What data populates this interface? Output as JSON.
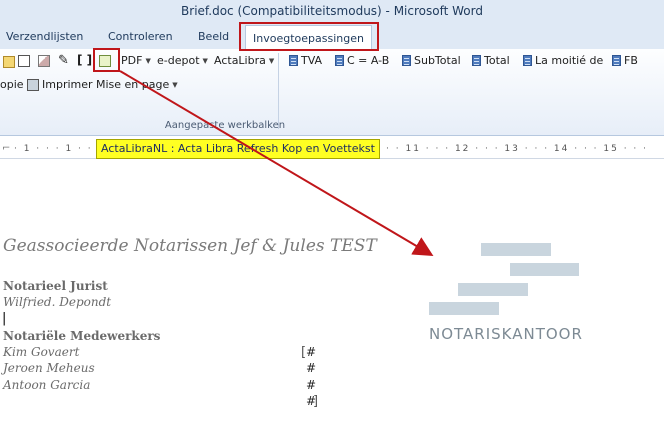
{
  "window": {
    "title": "Brief.doc (Compatibiliteitsmodus)  -  Microsoft Word",
    "ghost_left": "Brief",
    "ghost_right": ""
  },
  "tabs": [
    {
      "label": "Verzendlijsten"
    },
    {
      "label": "Controleren"
    },
    {
      "label": "Beeld"
    },
    {
      "label": "Invoegtoepassingen"
    }
  ],
  "ribbon": {
    "row1": {
      "pdf": "PDF",
      "edepot": "e-depot",
      "actalibra": "ActaLibra"
    },
    "row2": {
      "copie": "opie",
      "imprimer": "Imprimer",
      "mise": "Mise en page"
    },
    "toolbar": [
      "TVA",
      "C = A-B",
      "SubTotal",
      "Total",
      "La moitié de",
      "FB"
    ],
    "group_label": "Aangepaste werkbalken"
  },
  "tooltip": "ActaLibraNL : Acta Libra Refresh Kop en Voettekst",
  "document": {
    "firm": "Geassocieerde Notarissen Jef & Jules TEST",
    "section1_heading": "Notarieel Jurist",
    "section1_names": [
      "Wilfried. Depondt"
    ],
    "cursor": "|",
    "section2_heading": "Notariële Medewerkers",
    "section2_names": [
      "Kim Govaert",
      "Jeroen Meheus",
      "Antoon Garcia"
    ],
    "placeholders": [
      "#",
      "#",
      "#",
      "#"
    ]
  },
  "logo": {
    "text": "NOTARISKANTOOR"
  },
  "colors": {
    "annotation": "#c0161a",
    "tooltip": "#ffff22",
    "ribbon": "#dfe9f5"
  }
}
